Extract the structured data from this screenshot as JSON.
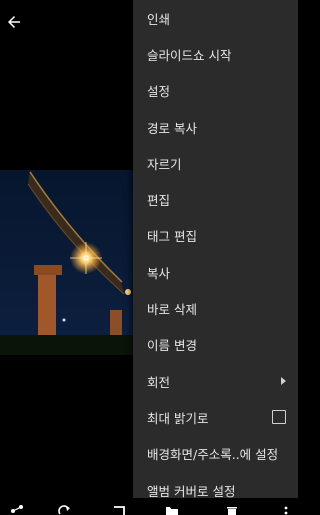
{
  "toolbar": {
    "back_icon": "arrow-left-icon"
  },
  "menu": {
    "items": [
      {
        "label": "인쇄"
      },
      {
        "label": "슬라이드쇼 시작"
      },
      {
        "label": "설정"
      },
      {
        "label": "경로 복사"
      },
      {
        "label": "자르기"
      },
      {
        "label": "편집"
      },
      {
        "label": "태그 편집"
      },
      {
        "label": "복사"
      },
      {
        "label": "바로 삭제"
      },
      {
        "label": "이름 변경"
      },
      {
        "label": "회전",
        "submenu": true
      },
      {
        "label": "최대 밝기로",
        "checked": false
      },
      {
        "label": "배경화면/주소록..에 설정"
      },
      {
        "label": "앨범 커버로 설정"
      }
    ]
  },
  "bottom_bar": {
    "icons": [
      "share-icon",
      "rotate-icon",
      "crop-icon",
      "folder-icon",
      "delete-icon",
      "more-icon"
    ]
  },
  "colors": {
    "menu_bg": "#2b2b2b",
    "menu_text": "#e6e6e6",
    "background": "#000000"
  }
}
